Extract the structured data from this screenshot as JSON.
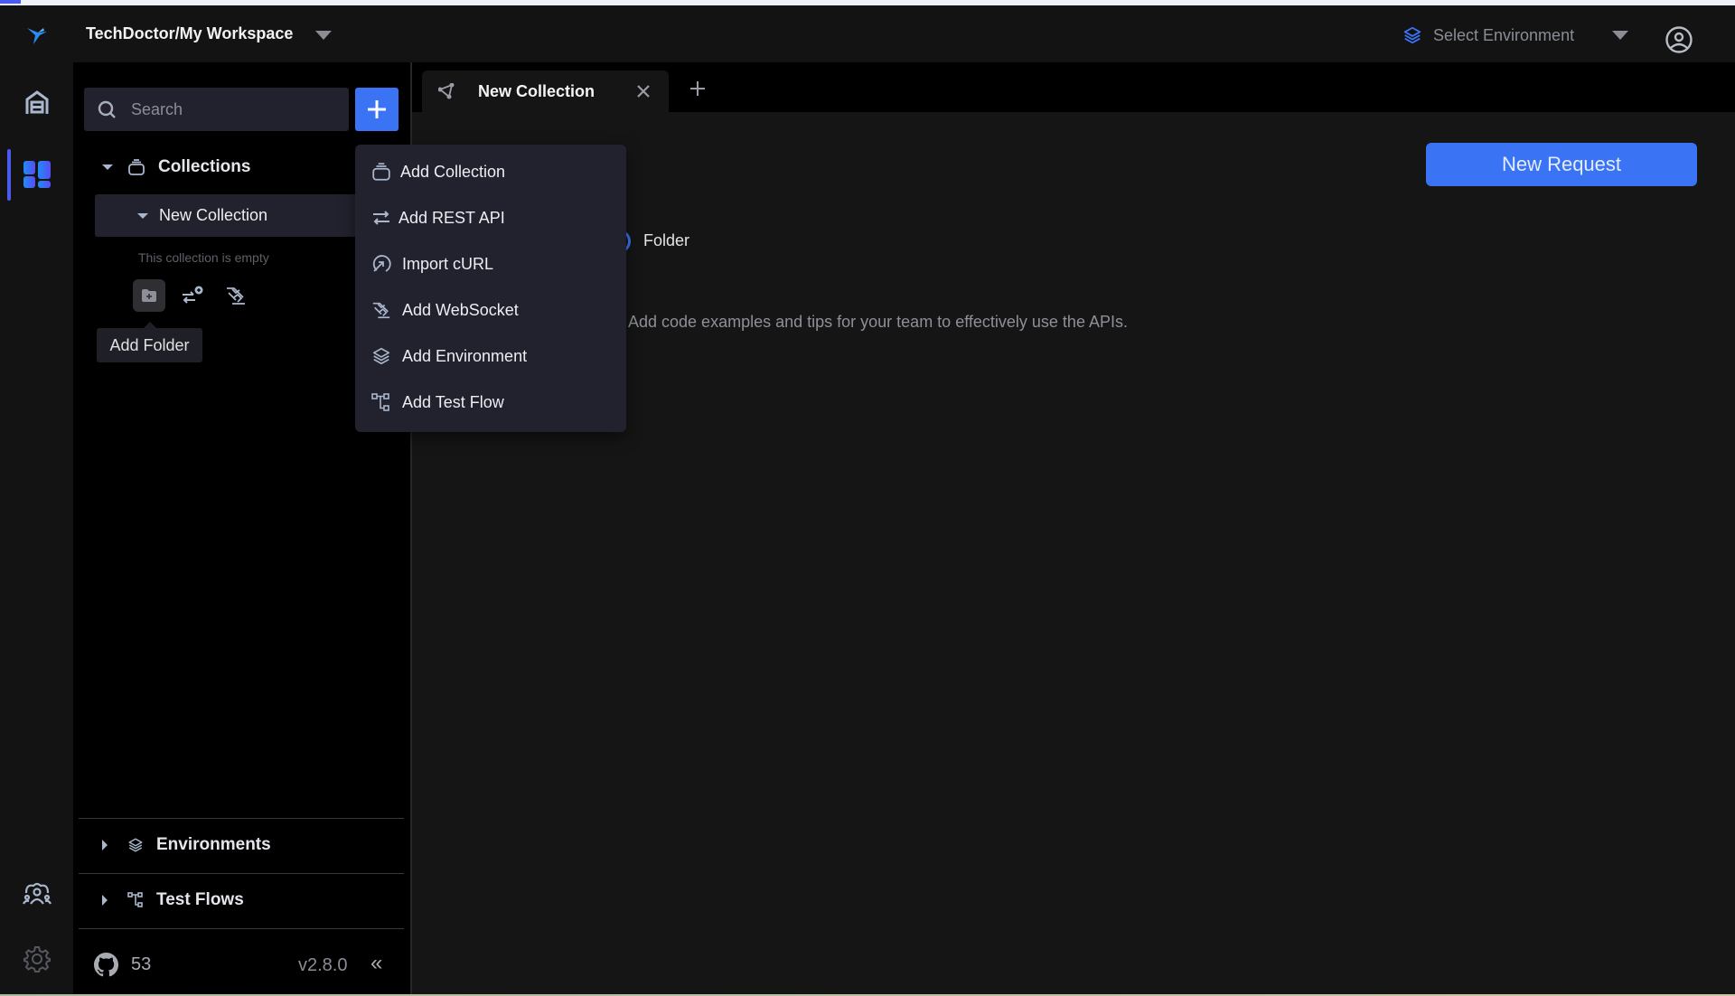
{
  "header": {
    "workspace": "TechDoctor/My Workspace",
    "environment_placeholder": "Select Environment"
  },
  "sidebar": {
    "search_placeholder": "Search",
    "collections_label": "Collections",
    "collection_name": "New Collection",
    "empty_text": "This collection is empty",
    "tooltip": "Add Folder",
    "environments_label": "Environments",
    "testflows_label": "Test Flows",
    "github_stars": "53",
    "version": "v2.8.0",
    "collapse_glyph": "«"
  },
  "tabs": [
    {
      "label": "New Collection",
      "active": true
    }
  ],
  "main": {
    "folder_label": "Folder",
    "description": "Add code examples and tips for your team to effectively use the APIs.",
    "new_request_label": "New Request"
  },
  "add_menu": {
    "items": [
      {
        "label": "Add Collection",
        "icon": "collection-icon"
      },
      {
        "label": "Add REST API",
        "icon": "rest-api-icon"
      },
      {
        "label": "Import cURL",
        "icon": "import-curl-icon"
      },
      {
        "label": "Add WebSocket",
        "icon": "websocket-icon"
      },
      {
        "label": "Add Environment",
        "icon": "environment-icon"
      },
      {
        "label": "Add Test Flow",
        "icon": "testflow-icon"
      }
    ]
  },
  "colors": {
    "accent": "#3a74f5",
    "rail_active": "#4a5cf0",
    "panel": "#22222e",
    "background": "#151515"
  }
}
